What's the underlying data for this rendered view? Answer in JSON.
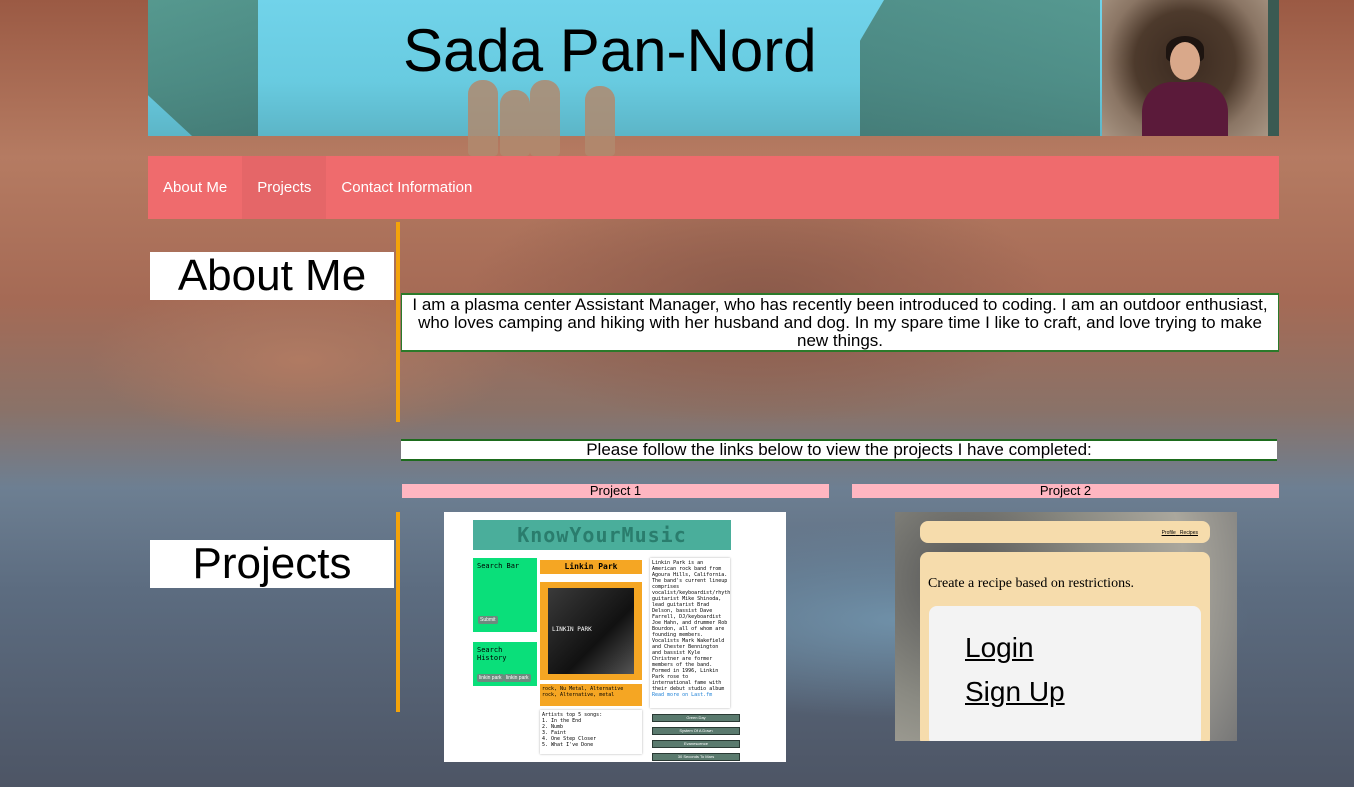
{
  "header": {
    "title": "Sada Pan-Nord",
    "profile_photo": "profile-photo"
  },
  "nav": {
    "items": [
      {
        "label": "About Me"
      },
      {
        "label": "Projects"
      },
      {
        "label": "Contact Information"
      }
    ]
  },
  "about": {
    "heading": "About Me",
    "text": "I am a plasma center Assistant Manager, who has recently been introduced to coding. I am an outdoor enthusiast, who loves camping and hiking with her husband and dog. In my spare time I like to craft, and love trying to make new things."
  },
  "projects": {
    "heading": "Projects",
    "intro": "Please follow the links below to view the projects I have completed:",
    "items": [
      {
        "label": "Project 1",
        "preview": {
          "title": "KnowYourMusic",
          "search_label": "Search Bar",
          "submit": "Submit",
          "history_label": "Search History",
          "history_buttons": [
            "linkin park",
            "linkin park"
          ],
          "artist": "Linkin Park",
          "album_logo": "LINKIN PARK",
          "genres": "rock, Nu Metal, Alternative rock, Alternative, metal",
          "songs_title": "Artists top 5 songs:",
          "songs": [
            "1. In the End",
            "2. Numb",
            "3. Faint",
            "4. One Step Closer",
            "5. What I've Done"
          ],
          "bio": "Linkin Park is an American rock band from Agoura Hills, California. The band's current lineup comprises vocalist/keyboardist/rhythm guitarist Mike Shinoda, lead guitarist Brad Delson, bassist Dave Farrell, DJ/keyboardist Joe Hahn, and drummer Rob Bourdon, all of whom are founding members. Vocalists Mark Wakefield and Chester Bennington and bassist Kyle Christner are former members of the band. Formed in 1996, Linkin Park rose to international fame with their debut studio album",
          "read_more": "Read more on Last.fm",
          "links": [
            "Green Day",
            "System Of A Down",
            "Evanescence",
            "30 Seconds To Mars"
          ]
        }
      },
      {
        "label": "Project 2",
        "preview": {
          "nav_links": [
            "Profile",
            "Recipes"
          ],
          "tagline": "Create a recipe based on restrictions.",
          "login": "Login",
          "signup": "Sign Up"
        }
      }
    ]
  },
  "colors": {
    "nav_bg": "#ef6b6d",
    "accent_bar": "#f4a30a",
    "project_label_bg": "#ffb6c1",
    "border_green": "#1d6b1d"
  }
}
